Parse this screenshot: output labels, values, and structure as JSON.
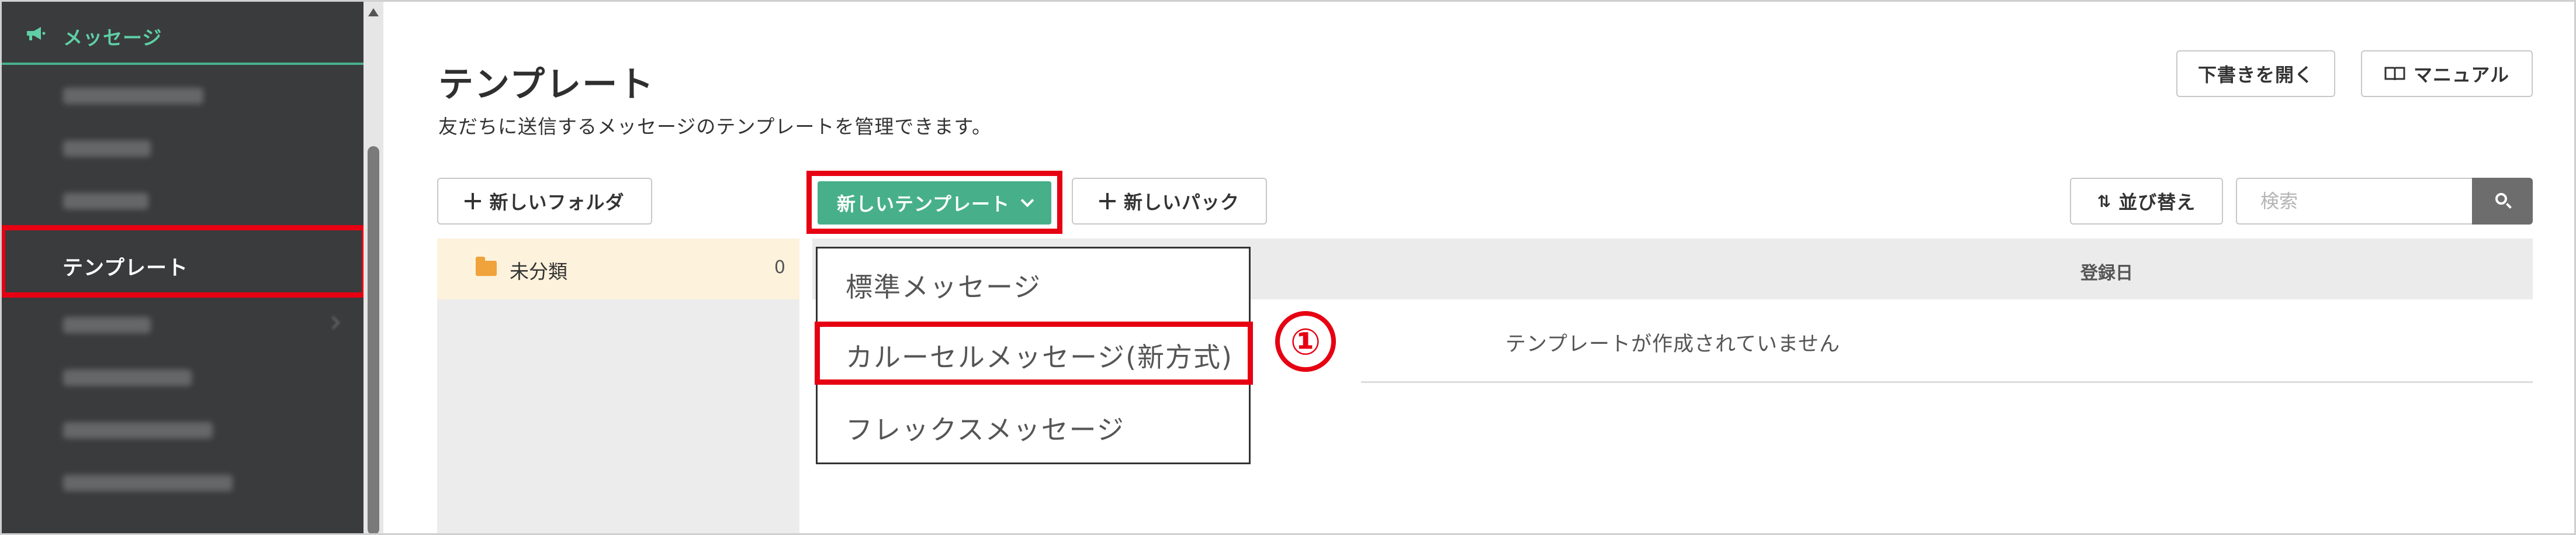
{
  "sidebar": {
    "section_title": "メッセージ",
    "section_icon": "megaphone-icon",
    "active_item": "テンプレート",
    "blurred_items_count_note": ""
  },
  "header": {
    "title": "テンプレート",
    "subtitle": "友だちに送信するメッセージのテンプレートを管理できます。",
    "draft_button": "下書きを開く",
    "manual_button": "マニュアル"
  },
  "toolbar": {
    "new_folder": "新しいフォルダ",
    "new_template": "新しいテンプレート",
    "new_pack": "新しいパック",
    "sort": "並び替え",
    "search_placeholder": "検索"
  },
  "folders": [
    {
      "label": "未分類",
      "count": "0"
    }
  ],
  "list": {
    "date_column": "登録日",
    "empty_message": "テンプレートが作成されていません"
  },
  "dropdown": {
    "items": [
      "標準メッセージ",
      "カルーセルメッセージ(新方式)",
      "フレックスメッセージ"
    ]
  },
  "annotation": {
    "step": "①"
  },
  "colors": {
    "accent_green": "#47b08b",
    "highlight_red": "#e60012",
    "sidebar_bg": "#3a3b3c"
  }
}
